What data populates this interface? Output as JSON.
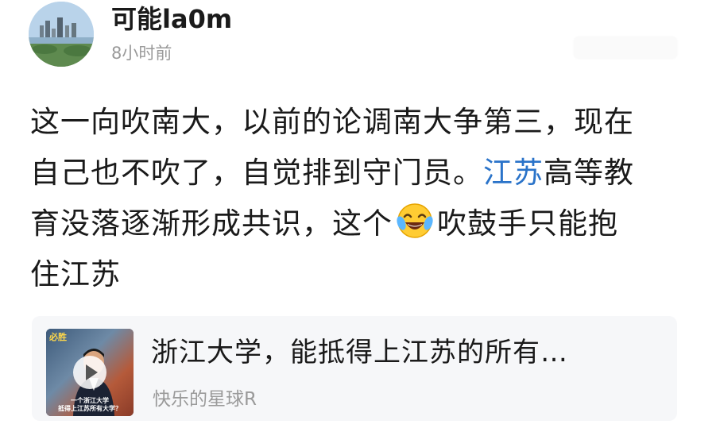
{
  "post": {
    "author": "可能la0m",
    "time": "8小时前",
    "body": {
      "line1": "这一向吹南大，以前的论调南大争第三，现在",
      "line2_pre": "自己也不吹了，自觉排到守门员。",
      "line2_link": "江苏",
      "line2_post": "高等教",
      "line3_pre": "育没落逐渐形成共识，这个",
      "line3_emoji": "laughing-tears-emoji",
      "line3_post": "吹鼓手只能抱",
      "line4": "住江苏"
    },
    "link_color": "#2a73c9"
  },
  "shared_card": {
    "title": "浙江大学，能抵得上江苏的所有…",
    "source": "快乐的星球R",
    "thumbnail": {
      "top_text": "必胜",
      "caption_line1": "一个浙江大学",
      "caption_line2": "抵得上江苏所有大学？"
    }
  }
}
